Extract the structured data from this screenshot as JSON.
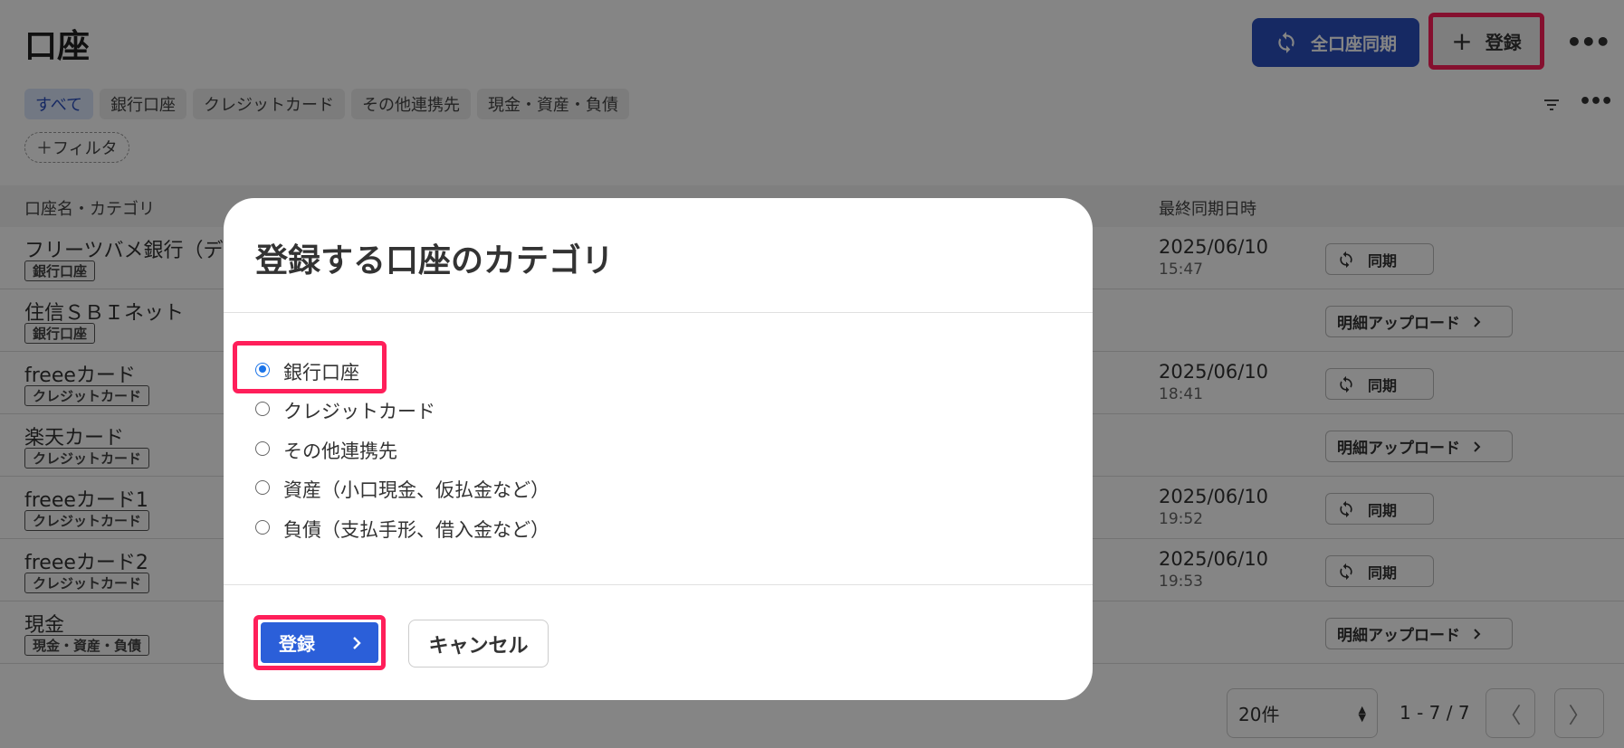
{
  "page": {
    "title": "口座"
  },
  "header": {
    "sync_all_label": "全口座同期",
    "register_label": "登録",
    "more_label": "•••"
  },
  "filters": {
    "chips": [
      "すべて",
      "銀行口座",
      "クレジットカード",
      "その他連携先",
      "現金・資産・負債"
    ],
    "active_chip": "すべて",
    "add_filter_label": "＋フィルタ",
    "more_label": "•••"
  },
  "table": {
    "headers": {
      "name": "口座名・カテゴリ",
      "last_sync": "最終同期日時"
    },
    "rows": [
      {
        "name": "フリーツバメ銀行（デモ",
        "category": "銀行口座",
        "date": "2025/06/10",
        "time": "15:47",
        "action": "同期"
      },
      {
        "name": "住信ＳＢＩネット",
        "category": "銀行口座",
        "date": "",
        "time": "",
        "action": "明細アップロード"
      },
      {
        "name": "freeeカード",
        "category": "クレジットカード",
        "date": "2025/06/10",
        "time": "18:41",
        "action": "同期"
      },
      {
        "name": "楽天カード",
        "category": "クレジットカード",
        "date": "",
        "time": "",
        "action": "明細アップロード"
      },
      {
        "name": "freeeカード1",
        "category": "クレジットカード",
        "date": "2025/06/10",
        "time": "19:52",
        "action": "同期"
      },
      {
        "name": "freeeカード2",
        "category": "クレジットカード",
        "date": "2025/06/10",
        "time": "19:53",
        "action": "同期"
      },
      {
        "name": "現金",
        "category": "現金・資産・負債",
        "date": "",
        "time": "",
        "action": "明細アップロード"
      }
    ]
  },
  "pagination": {
    "per_page": "20件",
    "range": "1 - 7 / 7"
  },
  "modal": {
    "title": "登録する口座のカテゴリ",
    "options": [
      {
        "label": "銀行口座",
        "checked": true
      },
      {
        "label": "クレジットカード",
        "checked": false
      },
      {
        "label": "その他連携先",
        "checked": false
      },
      {
        "label": "資産（小口現金、仮払金など）",
        "checked": false
      },
      {
        "label": "負債（支払手形、借入金など）",
        "checked": false
      }
    ],
    "register_label": "登録",
    "cancel_label": "キャンセル"
  },
  "colors": {
    "primary": "#2b4fbf",
    "highlight": "#ff1f5a",
    "radio": "#1a73e8"
  }
}
